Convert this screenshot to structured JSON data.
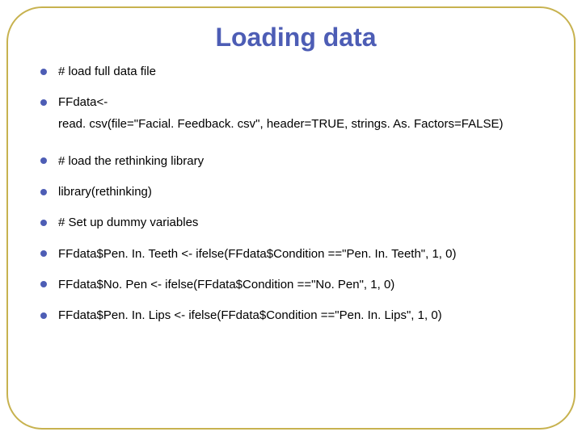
{
  "title": "Loading data",
  "bullets": [
    {
      "text": "# load full data file"
    },
    {
      "text": "FFdata<-",
      "sub": "read. csv(file=\"Facial. Feedback. csv\", header=TRUE, strings. As. Factors=FALSE)"
    },
    {
      "text": "# load the rethinking library"
    },
    {
      "text": "library(rethinking)"
    },
    {
      "text": "# Set up dummy variables"
    },
    {
      "text": "FFdata$Pen. In. Teeth <- ifelse(FFdata$Condition ==\"Pen. In. Teeth\", 1, 0)"
    },
    {
      "text": "FFdata$No. Pen <- ifelse(FFdata$Condition ==\"No. Pen\", 1, 0)"
    },
    {
      "text": "FFdata$Pen. In. Lips <- ifelse(FFdata$Condition ==\"Pen. In. Lips\", 1, 0)"
    }
  ]
}
